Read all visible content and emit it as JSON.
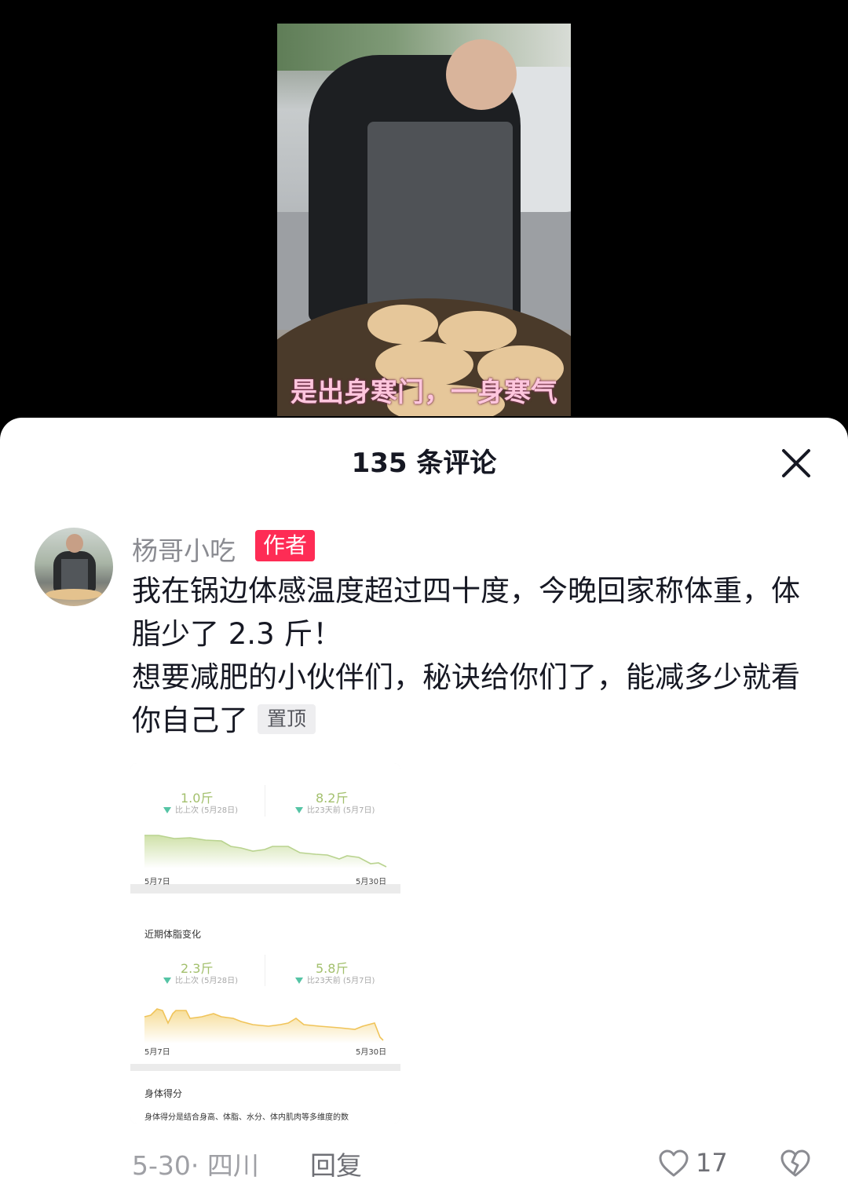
{
  "video": {
    "subtitle": "是出身寒门，一身寒气"
  },
  "sheet": {
    "title": "135 条评论"
  },
  "comment": {
    "author_name": "杨哥小吃",
    "author_badge": "作者",
    "text": "我在锅边体感温度超过四十度，今晚回家称体重，体脂少了 2.3 斤！\n想要减肥的小伙伴们，秘诀给你们了，能减多少就看你自己了",
    "pinned_label": "置顶",
    "date_location": "5-30· 四川",
    "reply_label": "回复",
    "like_count": "17"
  },
  "attached_image": {
    "weight": {
      "left_value": "1.0斤",
      "left_sub": "比上次 (5月28日)",
      "right_value": "8.2斤",
      "right_sub": "比23天前 (5月7日)",
      "start_date": "5月7日",
      "end_date": "5月30日"
    },
    "bodyfat": {
      "heading": "近期体脂变化",
      "left_value": "2.3斤",
      "left_sub": "比上次 (5月28日)",
      "right_value": "5.8斤",
      "right_sub": "比23天前 (5月7日)",
      "start_date": "5月7日",
      "end_date": "5月30日"
    },
    "score": {
      "heading": "身体得分",
      "text": "身体得分是结合身高、体脂、水分、体内肌肉等多维度的数"
    }
  },
  "colors": {
    "badge_red": "#fe2c55",
    "weight_line": "#b9d38f",
    "bodyfat_line": "#f0c45a",
    "down_arrow": "#55c4a5"
  },
  "icons": {
    "close": "close-icon",
    "like": "heart-icon",
    "dislike": "broken-heart-icon"
  }
}
